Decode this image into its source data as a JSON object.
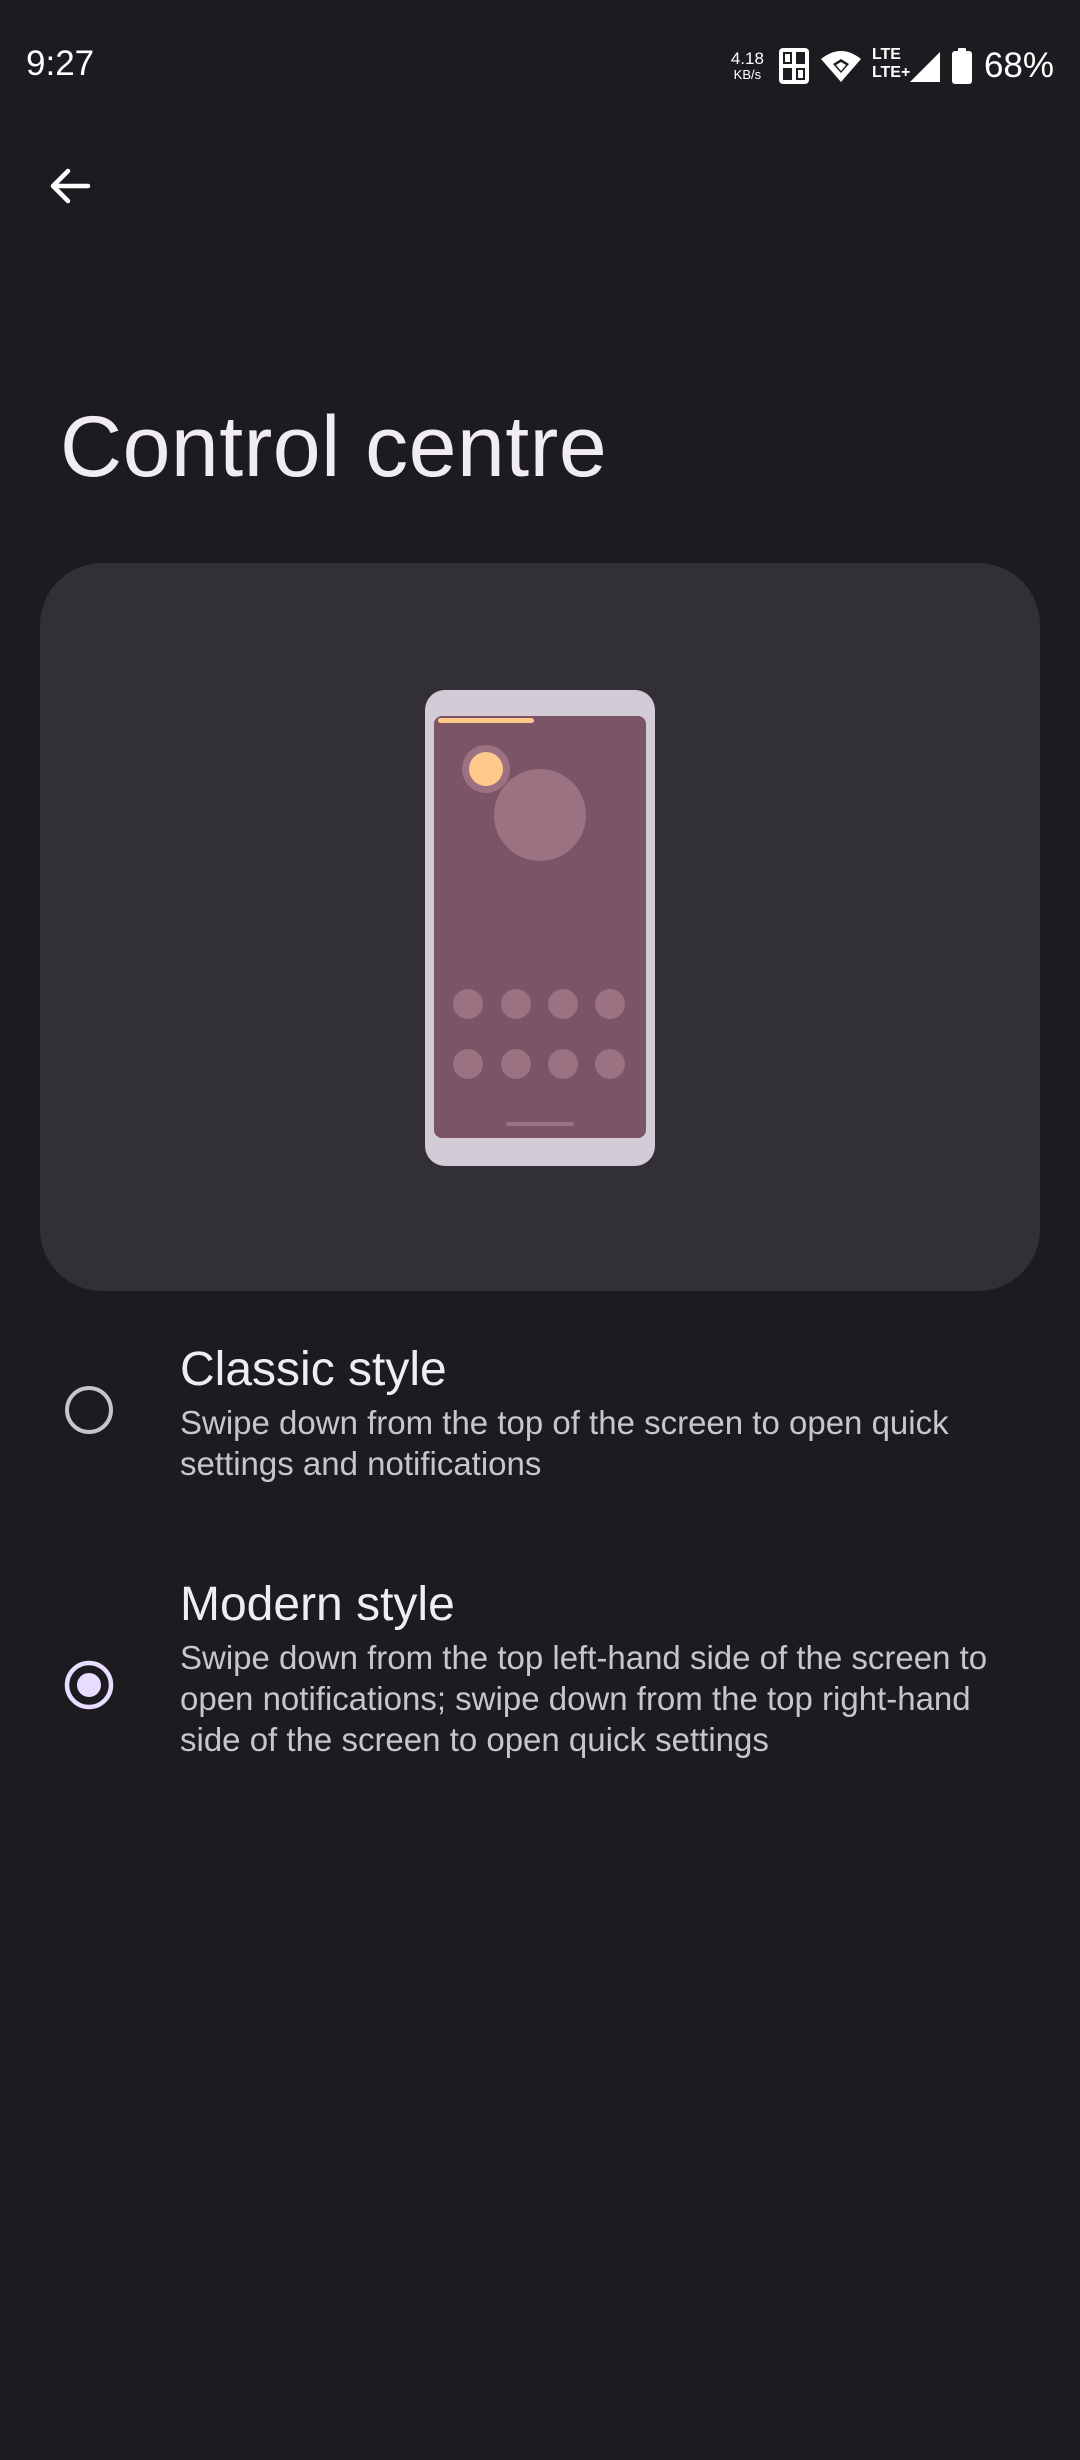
{
  "status_bar": {
    "time": "9:27",
    "net_speed_value": "4.18",
    "net_speed_unit": "KB/s",
    "lte_top": "LTE",
    "lte_bottom": "LTE+",
    "battery": "68%"
  },
  "header": {
    "back_icon": "arrow-back-icon",
    "title": "Control centre"
  },
  "preview": {
    "icon": "phone-illustration",
    "colors": {
      "card": "#323036",
      "phone_frame": "#d3cbd6",
      "phone_screen": "#7b5565",
      "accent": "#ffc98b"
    }
  },
  "options": [
    {
      "title": "Classic style",
      "description": "Swipe down from the top of the screen to open quick settings and notifications",
      "selected": false
    },
    {
      "title": "Modern style",
      "description": "Swipe down from the top left-hand side of the screen to open notifications; swipe down from the top right-hand side of the screen to open quick settings",
      "selected": true
    }
  ],
  "colors": {
    "background": "#1c1b20",
    "radio_selected": "#e8ddff",
    "radio_unselected": "#c9c3cd"
  }
}
